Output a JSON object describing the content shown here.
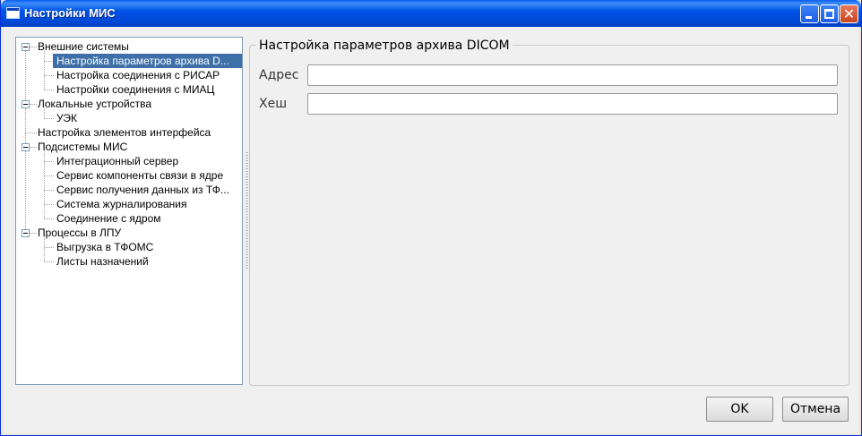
{
  "window": {
    "title": "Настройки МИС"
  },
  "tree": {
    "items": [
      {
        "label": "Внешние системы",
        "level": 0,
        "expanded": true,
        "selected": false
      },
      {
        "label": "Настройка параметров архива D...",
        "level": 1,
        "selected": true
      },
      {
        "label": "Настройка соединения с РИСАР",
        "level": 1,
        "selected": false
      },
      {
        "label": "Настройки соединения с МИАЦ",
        "level": 1,
        "selected": false
      },
      {
        "label": "Локальные устройства",
        "level": 0,
        "expanded": true,
        "selected": false
      },
      {
        "label": "УЭК",
        "level": 1,
        "selected": false
      },
      {
        "label": "Настройка элементов интерфейса",
        "level": 0,
        "selected": false
      },
      {
        "label": "Подсистемы МИС",
        "level": 0,
        "expanded": true,
        "selected": false
      },
      {
        "label": "Интеграционный сервер",
        "level": 1,
        "selected": false
      },
      {
        "label": "Сервис компоненты связи в ядре",
        "level": 1,
        "selected": false
      },
      {
        "label": "Сервис получения данных из ТФ...",
        "level": 1,
        "selected": false
      },
      {
        "label": "Система журналирования",
        "level": 1,
        "selected": false
      },
      {
        "label": "Соединение с ядром",
        "level": 1,
        "selected": false
      },
      {
        "label": "Процессы в ЛПУ",
        "level": 0,
        "expanded": true,
        "selected": false
      },
      {
        "label": "Выгрузка в ТФОМС",
        "level": 1,
        "selected": false
      },
      {
        "label": "Листы назначений",
        "level": 1,
        "selected": false
      }
    ]
  },
  "panel": {
    "title": "Настройка параметров архива DICOM",
    "fields": [
      {
        "label": "Адрес",
        "value": ""
      },
      {
        "label": "Хеш",
        "value": ""
      }
    ]
  },
  "buttons": {
    "ok": "OK",
    "cancel": "Отмена"
  },
  "colors": {
    "titlebar": "#0055e5",
    "selection": "#3d6fa8",
    "background": "#f0f0f0"
  }
}
